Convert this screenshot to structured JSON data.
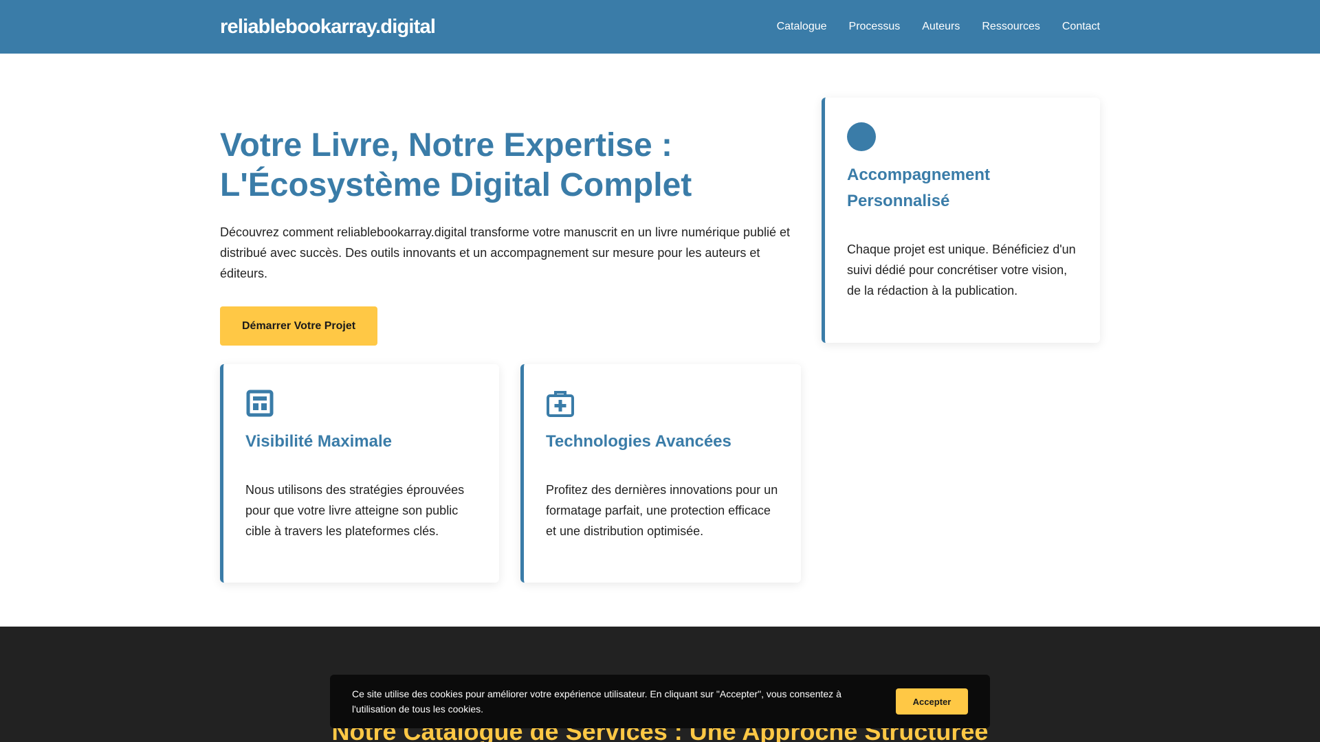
{
  "header": {
    "logo": "reliablebookarray.digital",
    "nav": [
      "Catalogue",
      "Processus",
      "Auteurs",
      "Ressources",
      "Contact"
    ]
  },
  "hero": {
    "title_line1": "Votre Livre, Notre Expertise :",
    "title_line2": "L'Écosystème Digital Complet",
    "description": "Découvrez comment reliablebookarray.digital transforme votre manuscrit en un livre numérique publié et distribué avec succès. Des outils innovants et un accompagnement sur mesure pour les auteurs et éditeurs.",
    "cta_label": "Démarrer Votre Projet"
  },
  "cards": [
    {
      "title": "Accompagnement Personnalisé",
      "text": "Chaque projet est unique. Bénéficiez d'un suivi dédié pour concrétiser votre vision, de la rédaction à la publication.",
      "icon": "circle-icon"
    },
    {
      "title": "Visibilité Maximale",
      "text": "Nous utilisons des stratégies éprouvées pour que votre livre atteigne son public cible à travers les plateformes clés.",
      "icon": "layout-icon"
    },
    {
      "title": "Technologies Avancées",
      "text": "Profitez des dernières innovations pour un formatage parfait, une protection efficace et une distribution optimisée.",
      "icon": "medkit-icon"
    }
  ],
  "catalogue_section": {
    "title": "Notre Catalogue de Services : Une Approche Structurée"
  },
  "cookie_banner": {
    "text": "Ce site utilise des cookies pour améliorer votre expérience utilisateur. En cliquant sur \"Accepter\", vous consentez à l'utilisation de tous les cookies.",
    "accept_label": "Accepter"
  },
  "colors": {
    "primary": "#3a7ca8",
    "accent": "#ffc845",
    "dark": "#222222"
  }
}
